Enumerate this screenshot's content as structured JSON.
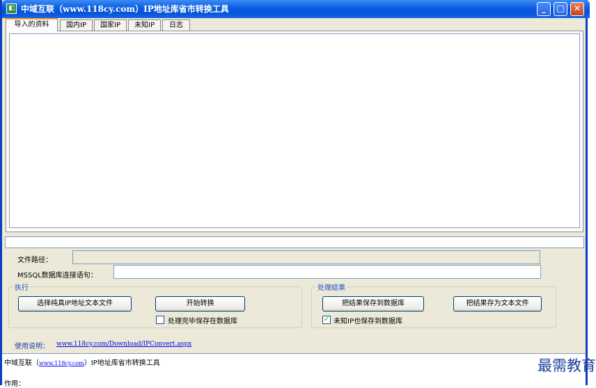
{
  "window": {
    "title": "中域互联（www.118cy.com）IP地址库省市转换工具",
    "title_icon": "app-icon",
    "controls": {
      "minimize": "_",
      "maximize": "□",
      "close": "✕"
    }
  },
  "tabs": [
    {
      "label": "导入的资料",
      "active": true
    },
    {
      "label": "国内IP"
    },
    {
      "label": "国家IP"
    },
    {
      "label": "未知IP"
    },
    {
      "label": "日志"
    }
  ],
  "form": {
    "file_path_label": "文件路径：",
    "file_path_value": "",
    "mssql_label": "MSSQL数据库连接语句：",
    "mssql_value": ""
  },
  "execute_group": {
    "legend": "执行",
    "select_file_button": "选择纯真IP地址文本文件",
    "start_button": "开始转换",
    "save_after_checkbox": {
      "label": "处理完毕保存在数据库",
      "checked": false
    }
  },
  "result_group": {
    "legend": "处理结果",
    "save_db_button": "把结果保存到数据库",
    "save_text_button": "把结果存为文本文件",
    "unknown_ip_checkbox": {
      "label": "未知IP也保存到数据库",
      "checked": true,
      "mark": "✓"
    }
  },
  "usage": {
    "label": "使用说明：",
    "url": "www.118cy.com/Download/IPConvert.aspx"
  },
  "log": {
    "line1_prefix": "中域互联（",
    "line1_url": "www.118cy.com",
    "line1_suffix": "）IP地址库省市转换工具",
    "line2": "作用："
  },
  "watermark": "最需教育",
  "colors": {
    "titlebar": "#0a5ce0",
    "window_bg": "#ece9d8",
    "legend_text": "#1c4fd0",
    "link": "#0000ee",
    "watermark": "#1c3fa0"
  }
}
